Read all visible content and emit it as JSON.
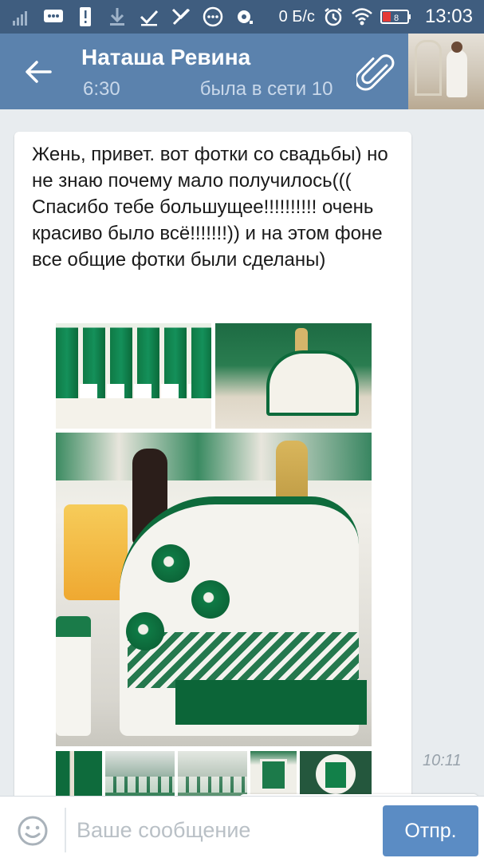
{
  "status_bar": {
    "network_speed": "0 Б/с",
    "time": "13:03",
    "battery_level": "8",
    "icons": [
      "signal-icon",
      "chat-notification-icon",
      "alert-icon",
      "download-icon",
      "check-icon",
      "missed-call-icon",
      "messages-icon",
      "voicemail-icon",
      "alarm-icon",
      "wifi-icon",
      "battery-icon"
    ]
  },
  "header": {
    "contact_name": "Наташа Ревина",
    "time_fragment": "6:30",
    "last_seen": "была в сети 10"
  },
  "message": {
    "text": "Жень, привет. вот фотки со свадьбы) но не знаю почему мало получилось((( Спасибо тебе большущее!!!!!!!!!! очень красиво было всё!!!!!!!)) и на этом фоне все общие фотки были сделаны)",
    "time": "10:11"
  },
  "input": {
    "placeholder": "Ваше сообщение",
    "value": "",
    "send_label": "Отпр."
  },
  "colors": {
    "status_bar": "#3f5d7f",
    "header": "#5b82ad",
    "chat_background": "#e8ecef",
    "send_button": "#5b8cc4",
    "wedding_green": "#0e6b3c"
  }
}
